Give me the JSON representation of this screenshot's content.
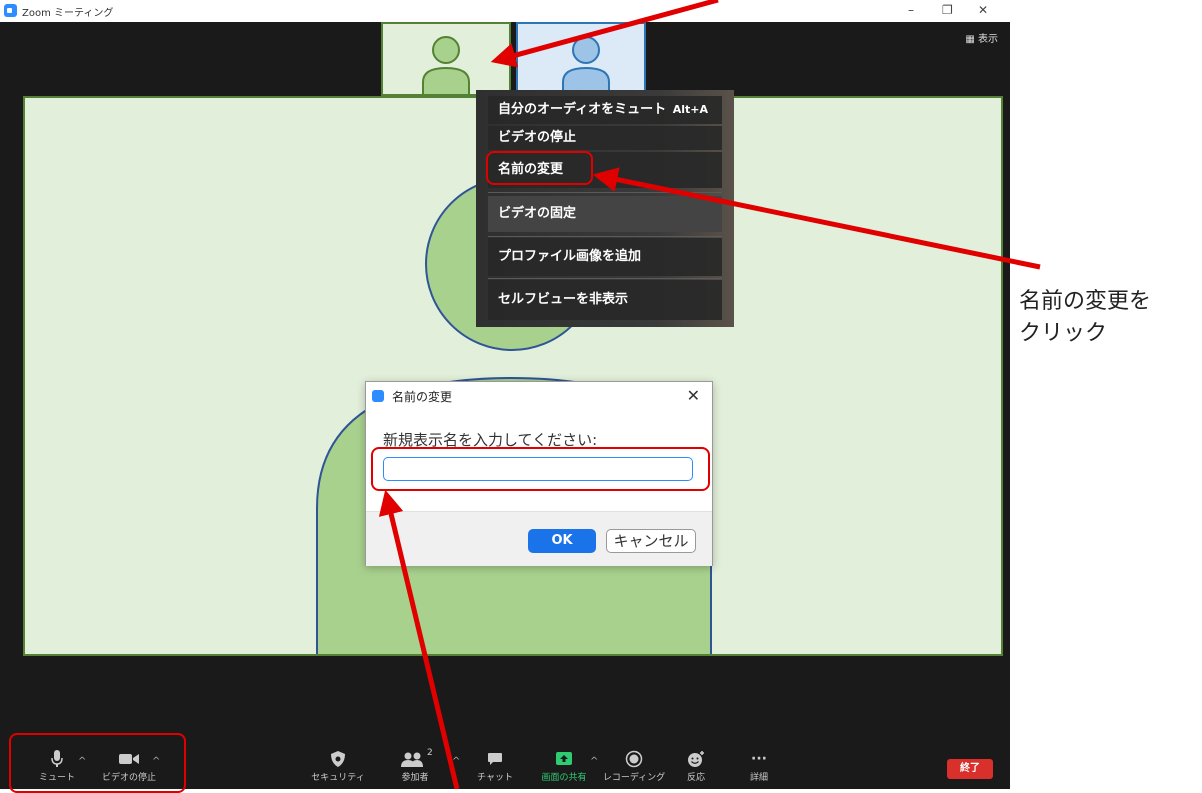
{
  "window": {
    "title": "Zoom ミーティング",
    "controls": {
      "minimize": "–",
      "restore": "❐",
      "close": "✕"
    },
    "view_button": "▦ 表示"
  },
  "context_menu": {
    "items": [
      {
        "label": "自分のオーディオをミュート",
        "shortcut": "Alt+A"
      },
      {
        "label": "ビデオの停止"
      },
      {
        "label": "名前の変更"
      },
      {
        "label": "ビデオの固定"
      },
      {
        "label": "プロファイル画像を追加"
      },
      {
        "label": "セルフビューを非表示"
      }
    ]
  },
  "rename_dialog": {
    "title": "名前の変更",
    "close": "✕",
    "prompt": "新規表示名を入力してください:",
    "input_value": "",
    "ok_label": "OK",
    "cancel_label": "キャンセル"
  },
  "toolbar": {
    "mute_label": "ミュート",
    "stop_video_label": "ビデオの停止",
    "security_label": "セキュリティ",
    "participants_label": "参加者",
    "participants_count": "2",
    "chat_label": "チャット",
    "share_label": "画面の共有",
    "record_label": "レコーディング",
    "reactions_label": "反応",
    "more_label": "詳細",
    "more_glyph": "···",
    "caret": "^",
    "end_label": "終了"
  },
  "annotation": {
    "callout_line1": "名前の変更を",
    "callout_line2": "クリック"
  },
  "colors": {
    "annotation_red": "#e00000",
    "zoom_blue": "#2D8CFF",
    "self_tile_fill": "#e2efda",
    "self_tile_border": "#548235",
    "other_tile_fill": "#dce9f6",
    "other_tile_border": "#2e75b6",
    "avatar_green": "#a9d18e",
    "avatar_blue": "#9dc3e6",
    "end_red": "#d9302c",
    "share_green": "#2ecc71"
  }
}
